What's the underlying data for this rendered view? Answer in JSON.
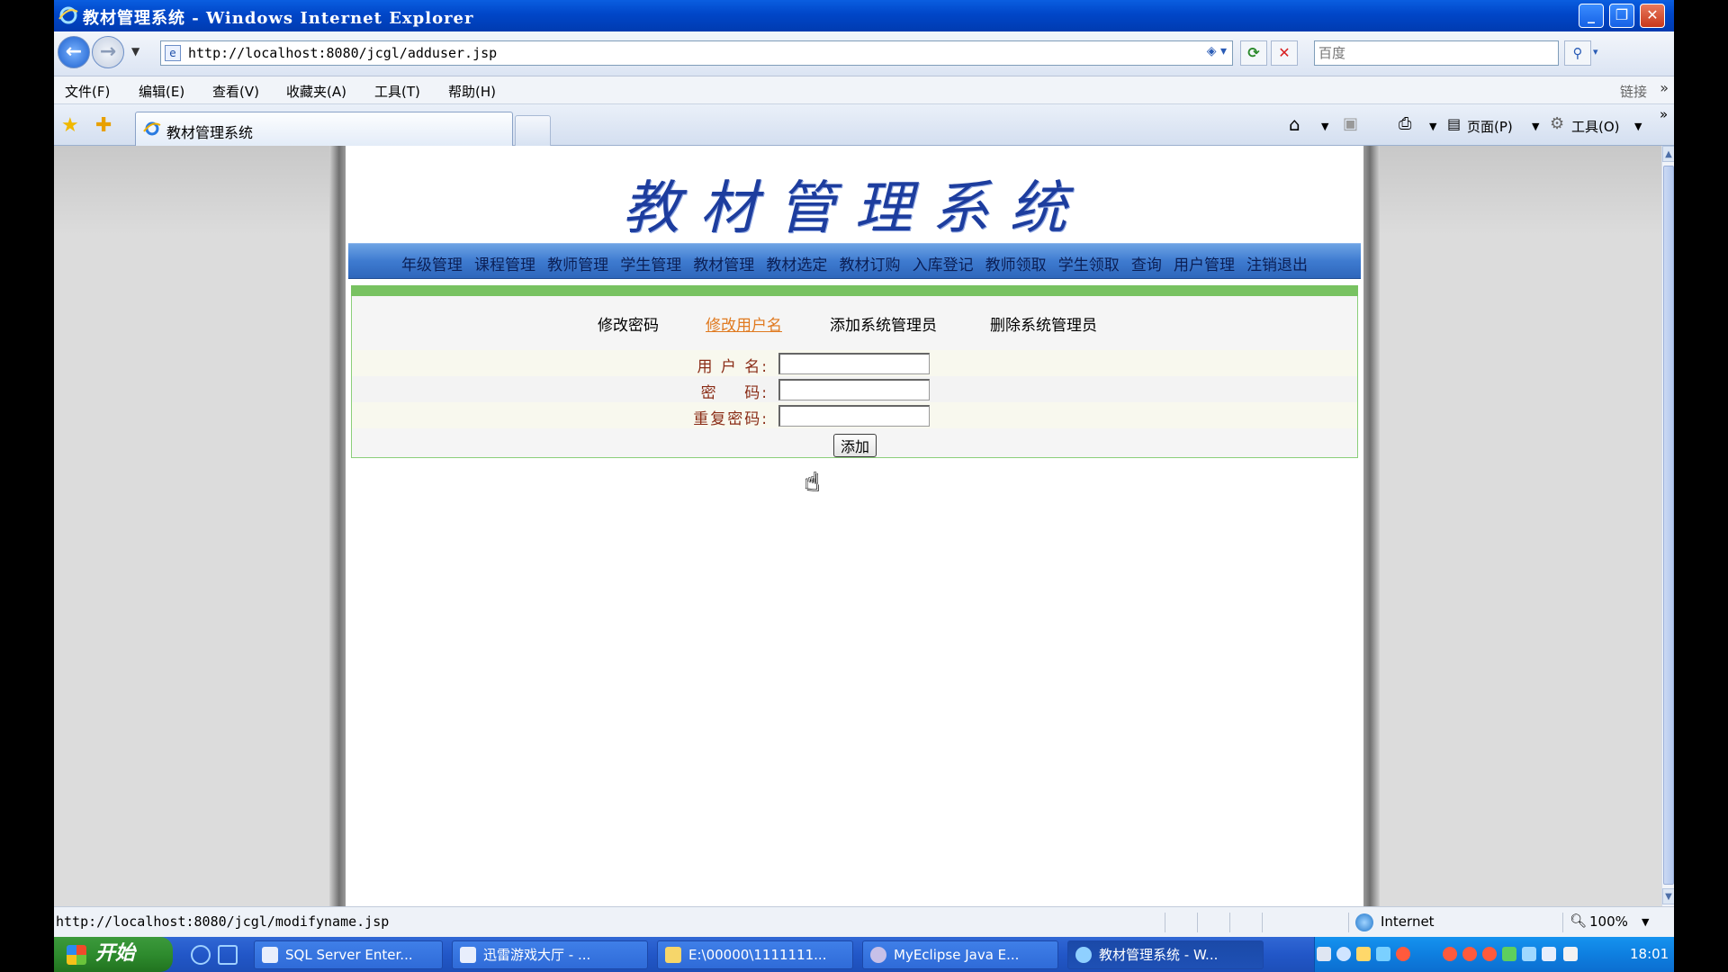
{
  "window": {
    "title": "教材管理系统 - Windows Internet Explorer"
  },
  "address": {
    "url": "http://localhost:8080/jcgl/adduser.jsp",
    "search_placeholder": "百度"
  },
  "menu": {
    "items": [
      "文件(F)",
      "编辑(E)",
      "查看(V)",
      "收藏夹(A)",
      "工具(T)",
      "帮助(H)"
    ],
    "links": "链接"
  },
  "tabs": {
    "active_title": "教材管理系统",
    "page_label": "页面(P)",
    "tools_label": "工具(O)"
  },
  "site": {
    "title": "教材管理系统",
    "nav": [
      "年级管理",
      "课程管理",
      "教师管理",
      "学生管理",
      "教材管理",
      "教材选定",
      "教材订购",
      "入库登记",
      "教师领取",
      "学生领取",
      "查询",
      "用户管理",
      "注销退出"
    ],
    "subnav": {
      "change_password": "修改密码",
      "change_username": "修改用户名",
      "add_admin": "添加系统管理员",
      "delete_admin": "删除系统管理员"
    },
    "form": {
      "username_label": "用 户 名:",
      "password_label": "密    码:",
      "repeat_password_label": "重复密码:",
      "username_value": "",
      "password_value": "",
      "repeat_password_value": "",
      "add_button": "添加"
    }
  },
  "status": {
    "text": "http://localhost:8080/jcgl/modifyname.jsp",
    "zone": "Internet",
    "zoom": "100%"
  },
  "taskbar": {
    "start": "开始",
    "tasks": [
      "SQL Server Enter...",
      "迅雷游戏大厅 - ...",
      "E:\\00000\\1111111...",
      "MyEclipse Java E...",
      "教材管理系统 - W..."
    ],
    "clock": "18:01"
  },
  "colors": {
    "title_blue": "#1d3d9e",
    "nav_bar": "#3e7bd0",
    "green_strip": "#78c261",
    "link_active": "#e07a20"
  }
}
